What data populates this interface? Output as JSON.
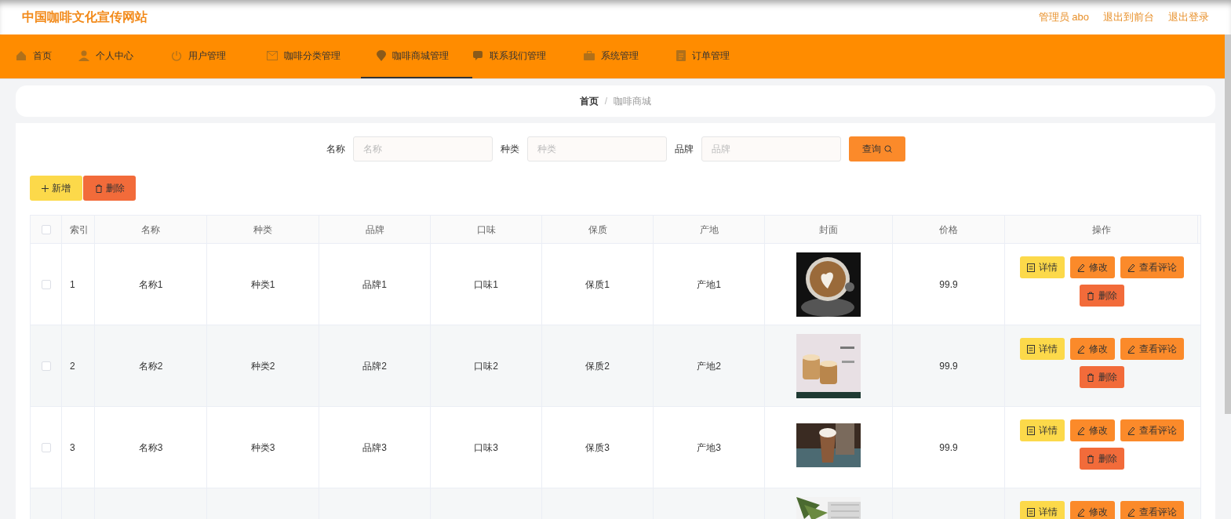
{
  "header": {
    "title": "中国咖啡文化宣传网站",
    "links": [
      "管理员 abo",
      "退出到前台",
      "退出登录"
    ]
  },
  "nav": [
    {
      "label": "首页",
      "selected": false
    },
    {
      "label": "个人中心",
      "selected": false
    },
    {
      "label": "用户管理",
      "selected": false
    },
    {
      "label": "咖啡分类管理",
      "selected": false
    },
    {
      "label": "咖啡商城管理",
      "selected": true
    },
    {
      "label": "联系我们管理",
      "selected": false
    },
    {
      "label": "系统管理",
      "selected": false
    },
    {
      "label": "订单管理",
      "selected": false
    }
  ],
  "breadcrumb": {
    "items": [
      "首页",
      "咖啡商城"
    ],
    "separator": "/"
  },
  "search": {
    "fields": [
      {
        "label": "名称",
        "placeholder": "名称"
      },
      {
        "label": "种类",
        "placeholder": "种类"
      },
      {
        "label": "品牌",
        "placeholder": "品牌"
      }
    ],
    "button": "查询"
  },
  "toolbar": {
    "add": "新增",
    "delete": "删除"
  },
  "table": {
    "select_all_checked": false,
    "columns": [
      "索引",
      "名称",
      "种类",
      "品牌",
      "口味",
      "保质",
      "产地",
      "封面",
      "价格",
      "操作"
    ],
    "rows": [
      {
        "checked": false,
        "cells": [
          "1",
          "名称1",
          "种类1",
          "品牌1",
          "口味1",
          "保质1",
          "产地1"
        ],
        "price": "99.9",
        "cover": {
          "kind": "picture"
        },
        "actions": [
          "详情",
          "修改",
          "查看评论",
          "删除"
        ]
      },
      {
        "checked": false,
        "cells": [
          "2",
          "名称2",
          "种类2",
          "品牌2",
          "口味2",
          "保质2",
          "产地2"
        ],
        "price": "99.9",
        "cover": {
          "kind": "picture"
        },
        "actions": [
          "详情",
          "修改",
          "查看评论",
          "删除"
        ]
      },
      {
        "checked": false,
        "cells": [
          "3",
          "名称3",
          "种类3",
          "品牌3",
          "口味3",
          "保质3",
          "产地3"
        ],
        "price": "99.9",
        "cover": {
          "kind": "picture"
        },
        "actions": [
          "详情",
          "修改",
          "查看评论",
          "删除"
        ]
      },
      {
        "cover": {
          "kind": "picture"
        },
        "actions": [
          "详情",
          "修改",
          "查看评论"
        ]
      }
    ]
  }
}
